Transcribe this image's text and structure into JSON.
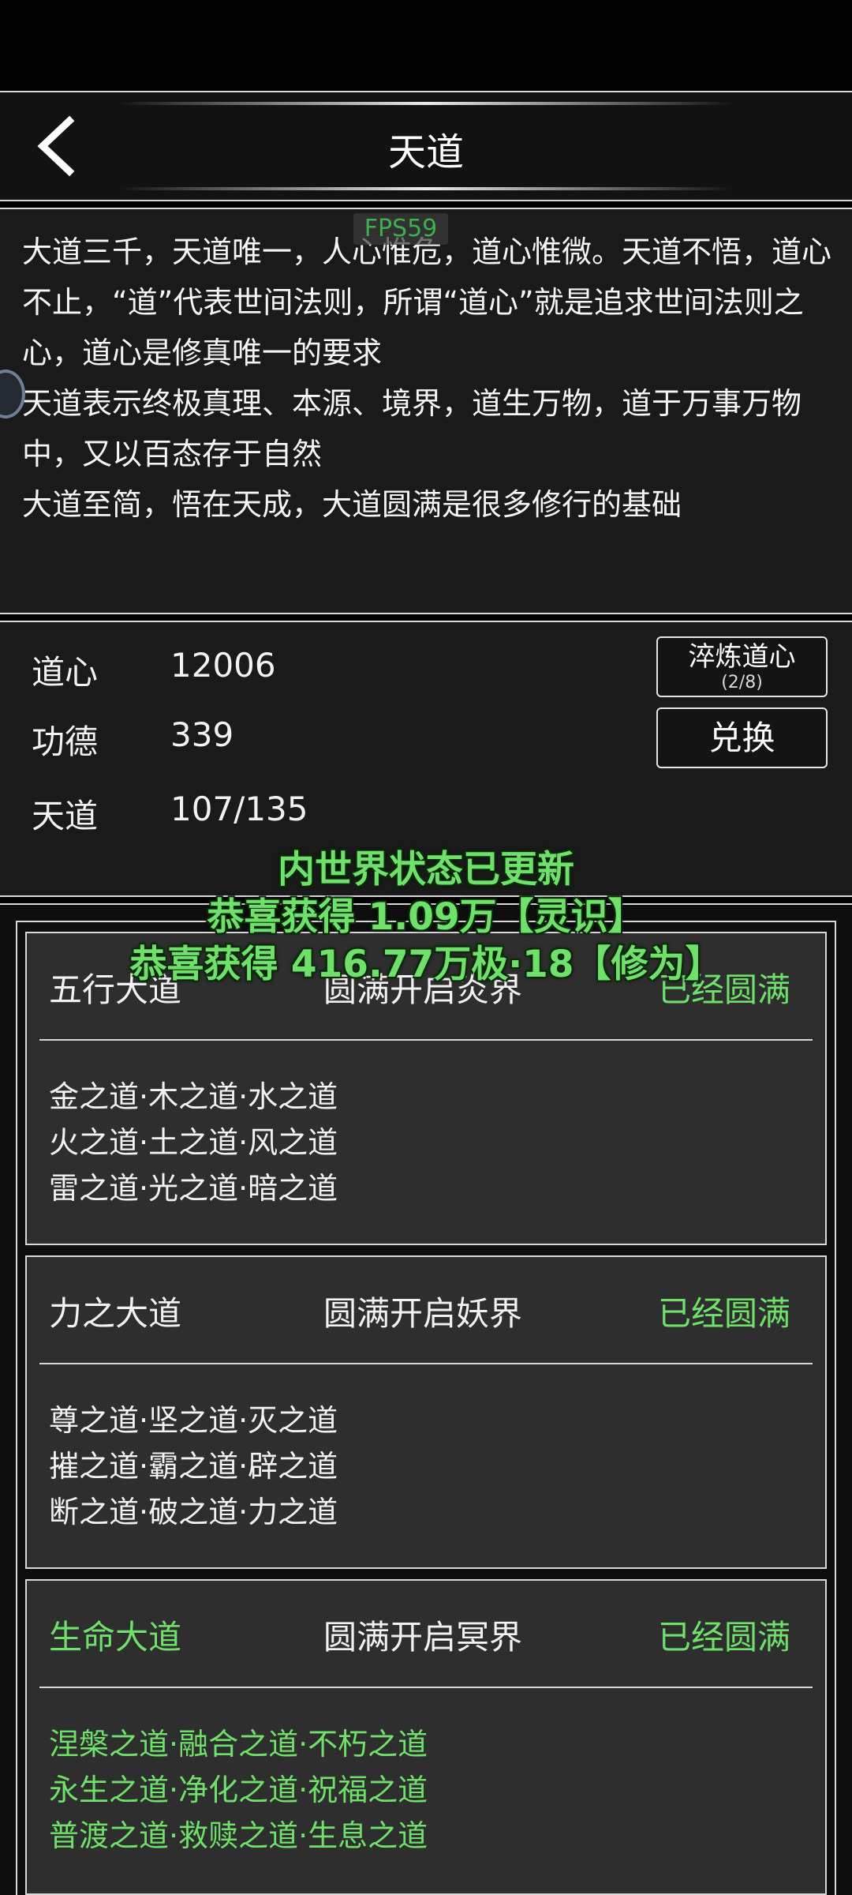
{
  "header": {
    "title": "天道",
    "back_icon": "chevron-left-icon"
  },
  "overlay": {
    "fps": "FPS59"
  },
  "description": [
    "大道三千，天道唯一，人心惟危，道心惟微。天道不悟，道心不止，“道”代表世间法则，所谓“道心”就是追求世间法则之心，道心是修真唯一的要求",
    "天道表示终极真理、本源、境界，道生万物，道于万事万物中，又以百态存于自然",
    "大道至简，悟在天成，大道圆满是很多修行的基础"
  ],
  "stats": [
    {
      "label": "道心",
      "value": "12006"
    },
    {
      "label": "功德",
      "value": "339"
    },
    {
      "label": "天道",
      "value": "107/135"
    }
  ],
  "buttons": {
    "refine_label": "淬炼道心",
    "refine_count": "(2/8)",
    "exchange_label": "兑换"
  },
  "toasts": [
    "内世界状态已更新",
    "恭喜获得 1.09万【灵识】",
    "恭喜获得 416.77万极·18【修为】"
  ],
  "cards": [
    {
      "title": "五行大道",
      "realm": "圆满开启炎界",
      "status": "已经圆满",
      "title_highlight": false,
      "items": [
        "金之道·木之道·水之道",
        "火之道·土之道·风之道",
        "雷之道·光之道·暗之道"
      ]
    },
    {
      "title": "力之大道",
      "realm": "圆满开启妖界",
      "status": "已经圆满",
      "title_highlight": false,
      "items": [
        "尊之道·坚之道·灭之道",
        "摧之道·霸之道·辟之道",
        "断之道·破之道·力之道"
      ]
    },
    {
      "title": "生命大道",
      "realm": "圆满开启冥界",
      "status": "已经圆满",
      "title_highlight": true,
      "items": [
        "涅槃之道·融合之道·不朽之道",
        "永生之道·净化之道·祝福之道",
        "普渡之道·救赎之道·生息之道"
      ]
    }
  ],
  "colors": {
    "accent_green": "#6fe06a",
    "panel": "#1a1a1a",
    "card": "#2e2e2e",
    "border": "#d9d9d9"
  }
}
